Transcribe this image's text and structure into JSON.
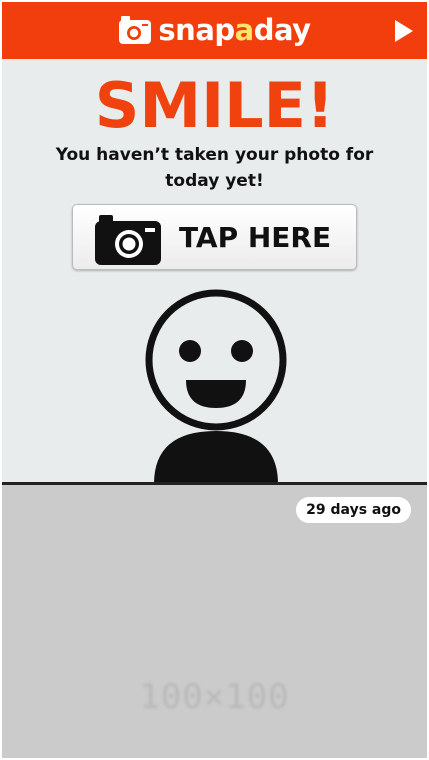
{
  "header": {
    "brand": {
      "part1": "snap",
      "part2": "a",
      "part3": "day"
    },
    "brand_icon": "camera-icon",
    "action_icon": "play-icon"
  },
  "main": {
    "title": "SMILE!",
    "subtitle": "You haven’t taken your photo for today yet!",
    "tap_button": {
      "label": "TAP HERE",
      "icon": "camera-icon"
    },
    "illustration_icon": "smiley-person-icon"
  },
  "photo": {
    "timestamp": "29 days ago",
    "placeholder": "100×100"
  },
  "colors": {
    "brand_red": "#f23d0c",
    "title_orange": "#f0420f",
    "brand_highlight": "#ffe36a",
    "background": "#e8ecec",
    "photo_background": "#cbcbcb"
  }
}
